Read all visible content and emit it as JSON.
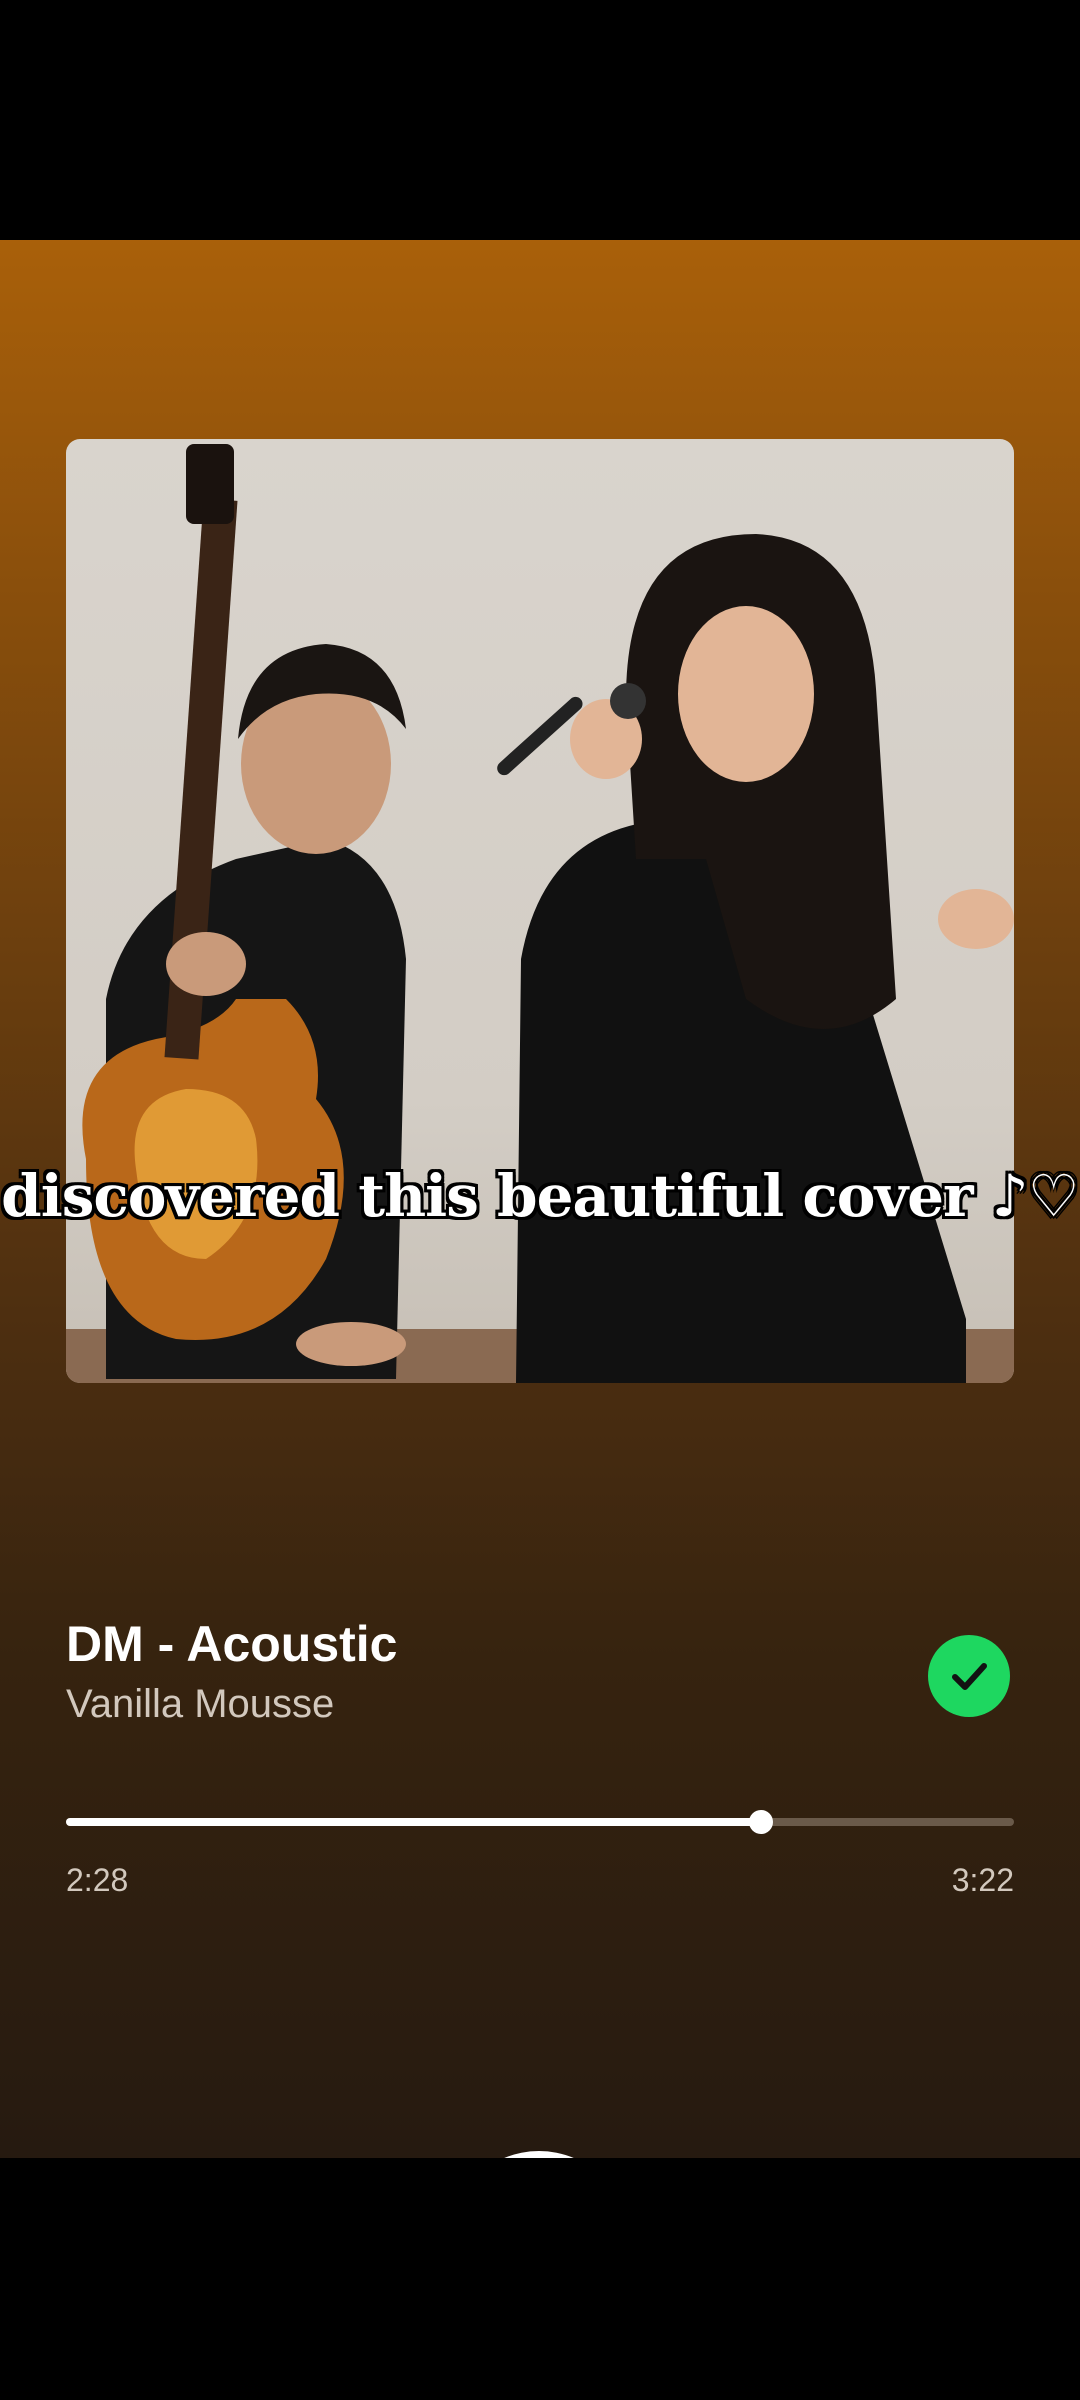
{
  "artwork": {
    "caption": "discovered this beautiful cover ♪♡"
  },
  "track": {
    "title": "DM - Acoustic",
    "artist": "Vanilla Mousse",
    "liked": true
  },
  "playback": {
    "elapsed": "2:28",
    "total": "3:22",
    "progress_fraction": 0.733,
    "state": "playing"
  },
  "controls": {
    "shuffle_icon": "shuffle-icon",
    "previous_icon": "skip-previous-icon",
    "pause_icon": "pause-icon",
    "next_icon": "skip-next-icon",
    "repeat_icon": "repeat-icon"
  },
  "colors": {
    "accent": "#1ed760",
    "gradient_top": "#a9600a",
    "gradient_bottom": "#261a10"
  }
}
